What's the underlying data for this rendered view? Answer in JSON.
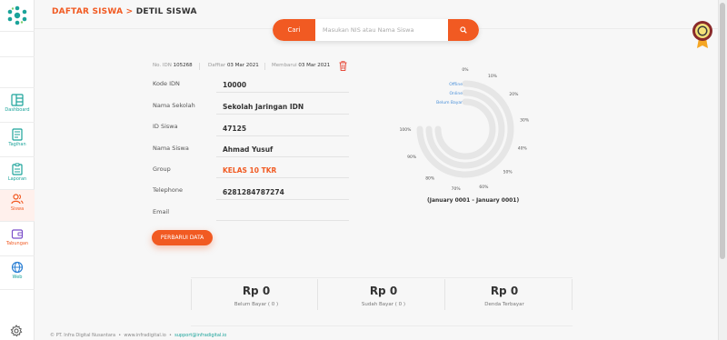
{
  "header": {
    "breadcrumb_parent": "DAFTAR SISWA",
    "breadcrumb_sep": " > ",
    "page_title": "DETIL SISWA"
  },
  "search": {
    "button_label": "Cari",
    "placeholder": "Masukan NIS atau Nama Siswa",
    "submit_icon": "search-icon"
  },
  "sidebar": {
    "items": [
      {
        "label": "Dashboard",
        "icon": "dashboard-icon"
      },
      {
        "label": "Tagihan",
        "icon": "invoice-icon"
      },
      {
        "label": "Laporan",
        "icon": "report-icon"
      },
      {
        "label": "Siswa",
        "icon": "users-icon"
      },
      {
        "label": "Tabungan",
        "icon": "wallet-icon"
      },
      {
        "label": "Web",
        "icon": "globe-icon"
      }
    ],
    "settings_icon": "gear-icon"
  },
  "meta": {
    "no_idn_label": "No. IDN",
    "no_idn_value": "105268",
    "created_label": "Dafftar",
    "created_value": "03 Mar 2021",
    "updated_label": "Membarui",
    "updated_value": "03 Mar 2021"
  },
  "fields": [
    {
      "label": "Kode IDN",
      "value": "10000"
    },
    {
      "label": "Nama Sekolah",
      "value": "Sekolah Jaringan IDN"
    },
    {
      "label": "ID Siswa",
      "value": "47125"
    },
    {
      "label": "Nama Siswa",
      "value": "Ahmad Yusuf"
    },
    {
      "label": "Group",
      "value": "KELAS 10 TKR"
    },
    {
      "label": "Telephone",
      "value": "6281284787274"
    },
    {
      "label": "Email",
      "value": ""
    }
  ],
  "update_button": "PERBARUI DATA",
  "chart_data": {
    "type": "radial-bar",
    "series": [
      {
        "name": "Offline",
        "value": 0
      },
      {
        "name": "Online",
        "value": 0
      },
      {
        "name": "Belum Bayar",
        "value": 0
      }
    ],
    "tick_labels": [
      "0%",
      "10%",
      "20%",
      "30%",
      "40%",
      "50%",
      "60%",
      "70%",
      "80%",
      "90%",
      "100%"
    ],
    "caption": "(January 0001 - January 0001)",
    "track_color": "#e6e6e6",
    "label_color": "#4a90d9"
  },
  "totals": [
    {
      "value": "Rp 0",
      "label": "Belum Bayar ( 0 )"
    },
    {
      "value": "Rp 0",
      "label": "Sudah Bayar ( 0 )"
    },
    {
      "value": "Rp 0",
      "label": "Denda Terbayar"
    }
  ],
  "footer": {
    "copyright": "© PT. Infra Digital Nusantara",
    "sep": "•",
    "site": "www.infradigital.io",
    "email": "support@infradigital.io"
  },
  "colors": {
    "accent": "#f15a22",
    "teal": "#1aa39a"
  }
}
